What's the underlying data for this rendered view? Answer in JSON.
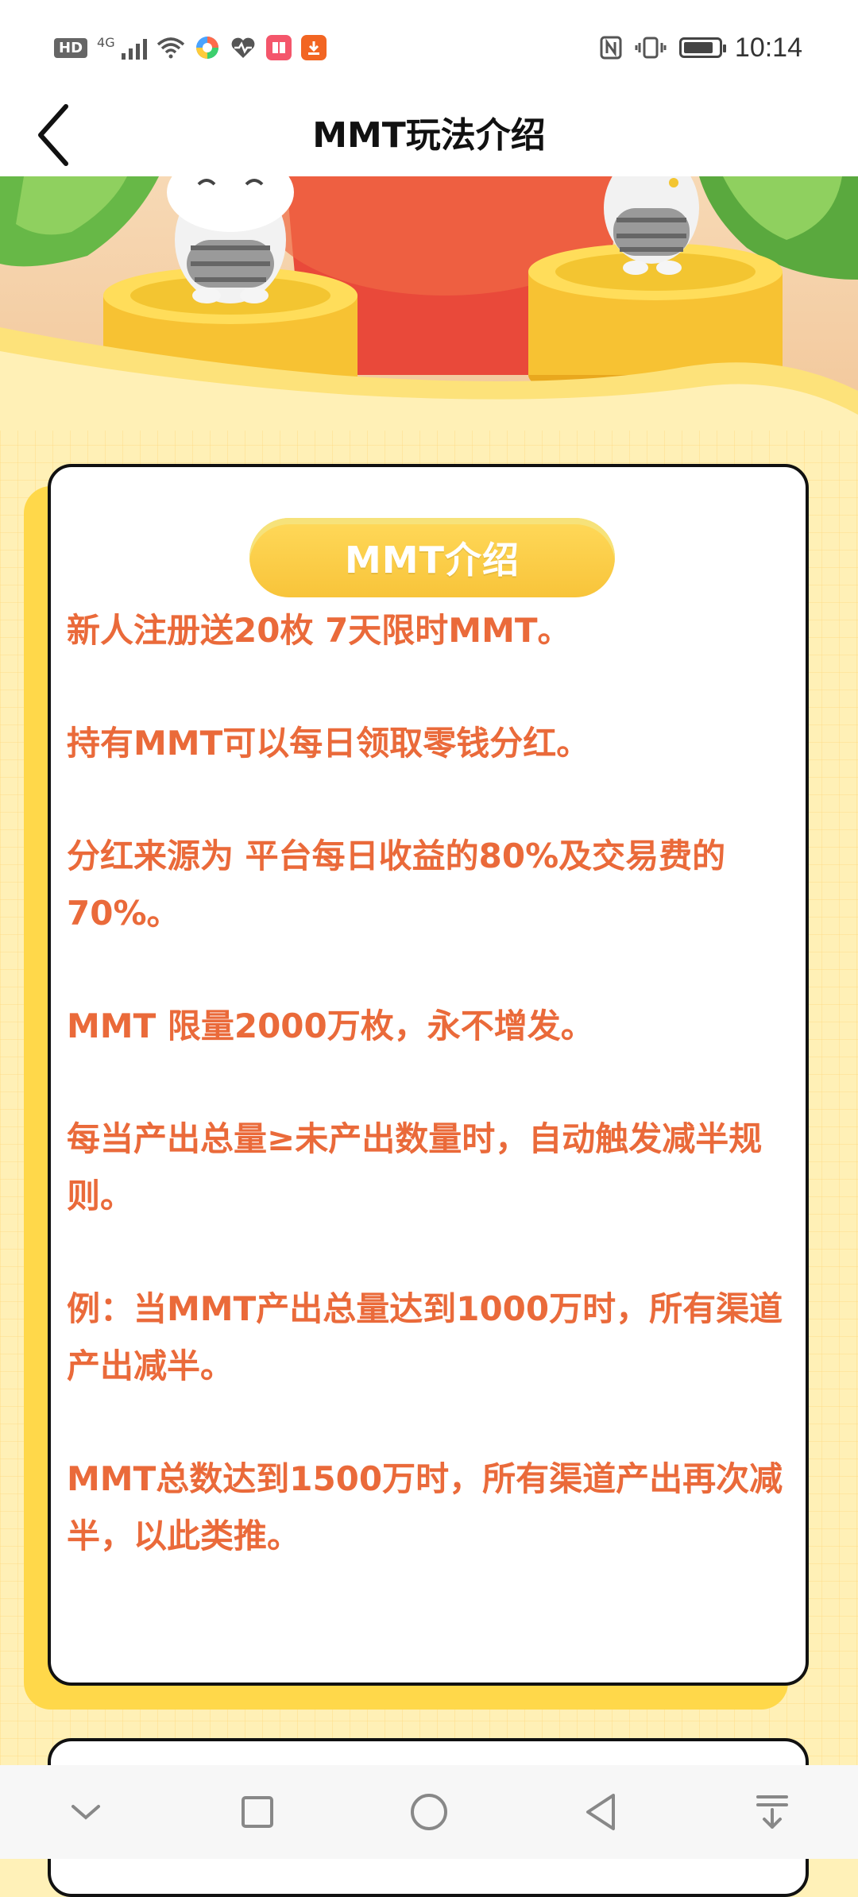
{
  "status_bar": {
    "hd": "HD",
    "network": "4G",
    "time": "10:14",
    "battery_level": 0.85
  },
  "header": {
    "title": "MMT玩法介绍"
  },
  "intro": {
    "heading": "MMT介绍",
    "paragraphs": [
      "新人注册送20枚 7天限时MMT。",
      "持有MMT可以每日领取零钱分红。",
      "分红来源为 平台每日收益的80%及交易费的70%。",
      "MMT 限量2000万枚，永不增发。",
      "每当产出总量≥未产出数量时，自动触发减半规则。",
      "例：当MMT产出总量达到1000万时，所有渠道产出减半。",
      "MMT总数达到1500万时，所有渠道产出再次减半，以此类推。"
    ]
  },
  "colors": {
    "accent_text": "#ea6a3a",
    "pill": "#f8c43a",
    "background": "#fff1b8"
  }
}
